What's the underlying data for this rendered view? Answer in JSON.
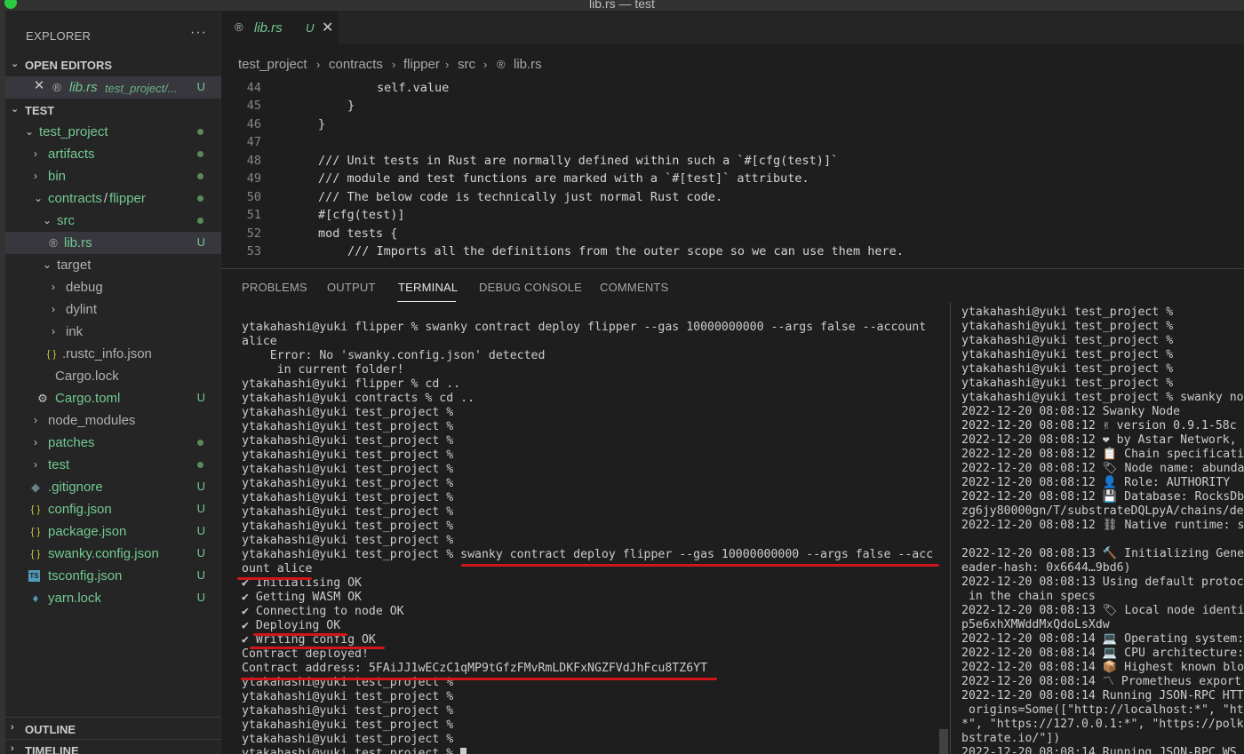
{
  "window": {
    "title": "lib.rs — test"
  },
  "explorer": {
    "header": "EXPLORER",
    "more": "···",
    "open_editors": {
      "label": "OPEN EDITORS",
      "item": {
        "name": "lib.rs",
        "path": "test_project/...",
        "badge": "U"
      }
    },
    "workspace": {
      "label": "TEST"
    },
    "tree": [
      {
        "name": "test_project",
        "badge": ""
      },
      {
        "name": "artifacts",
        "badge": ""
      },
      {
        "name": "bin",
        "badge": ""
      },
      {
        "name": "contracts",
        "sep": "/",
        "name2": "flipper",
        "badge": ""
      },
      {
        "name": "src",
        "badge": ""
      },
      {
        "name": "lib.rs",
        "badge": "U"
      },
      {
        "name": "target",
        "badge": ""
      },
      {
        "name": "debug",
        "badge": ""
      },
      {
        "name": "dylint",
        "badge": ""
      },
      {
        "name": "ink",
        "badge": ""
      },
      {
        "name": ".rustc_info.json",
        "badge": "",
        "icon_glyph": "{ }"
      },
      {
        "name": "Cargo.lock",
        "badge": ""
      },
      {
        "name": "Cargo.toml",
        "badge": "U"
      },
      {
        "name": "node_modules",
        "badge": ""
      },
      {
        "name": "patches",
        "badge": ""
      },
      {
        "name": "test",
        "badge": ""
      },
      {
        "name": ".gitignore",
        "badge": "U"
      },
      {
        "name": "config.json",
        "badge": "U",
        "icon_glyph": "{ }"
      },
      {
        "name": "package.json",
        "badge": "U",
        "icon_glyph": "{ }"
      },
      {
        "name": "swanky.config.json",
        "badge": "U",
        "icon_glyph": "{ }"
      },
      {
        "name": "tsconfig.json",
        "badge": "U",
        "icon_glyph": "TS"
      },
      {
        "name": "yarn.lock",
        "badge": "U"
      }
    ],
    "outline": "OUTLINE",
    "timeline": "TIMELINE"
  },
  "tab": {
    "name": "lib.rs",
    "badge": "U",
    "close": "✕"
  },
  "breadcrumb": [
    "test_project",
    "contracts",
    "flipper",
    "src",
    "lib.rs"
  ],
  "code": {
    "lines": [
      {
        "n": "44",
        "text": "self.value"
      },
      {
        "n": "45",
        "text": "}"
      },
      {
        "n": "46",
        "text": "}"
      },
      {
        "n": "47",
        "text": ""
      },
      {
        "n": "48",
        "text": "/// Unit tests in Rust are normally defined within such a `#[cfg(test)]`"
      },
      {
        "n": "49",
        "text": "/// module and test functions are marked with a `#[test]` attribute."
      },
      {
        "n": "50",
        "text": "/// The below code is technically just normal Rust code."
      },
      {
        "n": "51",
        "text": "#[cfg(test)]"
      },
      {
        "n": "52",
        "text": "mod tests {"
      },
      {
        "n": "53",
        "text": "/// Imports all the definitions from the outer scope so we can use them here."
      }
    ]
  },
  "panel": {
    "tabs": [
      "PROBLEMS",
      "OUTPUT",
      "TERMINAL",
      "DEBUG CONSOLE",
      "COMMENTS"
    ],
    "active_tab": "TERMINAL"
  },
  "terminal_left": [
    "ytakahashi@yuki flipper % swanky contract deploy flipper --gas 10000000000 --args false --account",
    "alice",
    "    Error: No 'swanky.config.json' detected",
    "     in current folder!",
    "ytakahashi@yuki flipper % cd ..",
    "ytakahashi@yuki contracts % cd ..",
    "ytakahashi@yuki test_project %",
    "ytakahashi@yuki test_project %",
    "ytakahashi@yuki test_project %",
    "ytakahashi@yuki test_project %",
    "ytakahashi@yuki test_project %",
    "ytakahashi@yuki test_project %",
    "ytakahashi@yuki test_project %",
    "ytakahashi@yuki test_project %",
    "ytakahashi@yuki test_project %",
    "ytakahashi@yuki test_project %",
    "ytakahashi@yuki test_project % swanky contract deploy flipper --gas 10000000000 --args false --acc",
    "ount alice",
    "✔ Initialising OK",
    "✔ Getting WASM OK",
    "✔ Connecting to node OK",
    "✔ Deploying OK",
    "✔ Writing config OK",
    "Contract deployed!",
    "Contract address: 5FAiJJ1wECzC1qMP9tGfzFMvRmLDKFxNGZFVdJhFcu8TZ6YT",
    "ytakahashi@yuki test_project %",
    "ytakahashi@yuki test_project %",
    "ytakahashi@yuki test_project %",
    "ytakahashi@yuki test_project %",
    "ytakahashi@yuki test_project %",
    "ytakahashi@yuki test_project % "
  ],
  "terminal_right": [
    "ytakahashi@yuki test_project %",
    "ytakahashi@yuki test_project %",
    "ytakahashi@yuki test_project %",
    "ytakahashi@yuki test_project %",
    "ytakahashi@yuki test_project %",
    "ytakahashi@yuki test_project %",
    "ytakahashi@yuki test_project % swanky no",
    "2022-12-20 08:08:12 Swanky Node",
    "2022-12-20 08:08:12 ✌ version 0.9.1-58c",
    "2022-12-20 08:08:12 ❤ by Astar Network,",
    "2022-12-20 08:08:12 📋 Chain specificati",
    "2022-12-20 08:08:12 🏷 Node name: abunda",
    "2022-12-20 08:08:12 👤 Role: AUTHORITY",
    "2022-12-20 08:08:12 💾 Database: RocksDb",
    "zg6jy80000gn/T/substrateDQLpyA/chains/de",
    "2022-12-20 08:08:12 ⛓ Native runtime: s",
    "",
    "2022-12-20 08:08:13 🔨 Initializing Gene",
    "eader-hash: 0x6644…9bd6)",
    "2022-12-20 08:08:13 Using default protoc",
    " in the chain specs",
    "2022-12-20 08:08:13 🏷 Local node identi",
    "p5e6xhXMWddMxQdoLsXdw",
    "2022-12-20 08:08:14 💻 Operating system:",
    "2022-12-20 08:08:14 💻 CPU architecture:",
    "2022-12-20 08:08:14 📦 Highest known blo",
    "2022-12-20 08:08:14 〽 Prometheus export",
    "2022-12-20 08:08:14 Running JSON-RPC HTT",
    " origins=Some([\"http://localhost:*\", \"ht",
    "*\", \"https://127.0.0.1:*\", \"https://polk",
    "bstrate.io/\"])",
    "2022-12-20 08:08:14 Running JSON-RPC WS"
  ]
}
